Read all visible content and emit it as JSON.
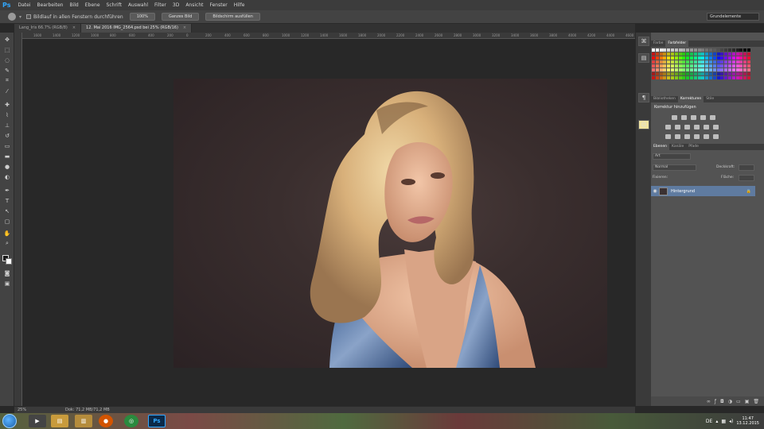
{
  "app": {
    "logo": "Ps"
  },
  "menu": [
    "Datei",
    "Bearbeiten",
    "Bild",
    "Ebene",
    "Schrift",
    "Auswahl",
    "Filter",
    "3D",
    "Ansicht",
    "Fenster",
    "Hilfe"
  ],
  "options": {
    "checkbox_label": "Bildlauf in allen Fenstern durchführen",
    "btn1": "100%",
    "btn2": "Ganzes Bild",
    "btn3": "Bildschirm ausfüllen",
    "workspace": "Grundelemente"
  },
  "tabs": [
    {
      "label": "Lang_Iris 66.7% (RGB/8)",
      "close": "×"
    },
    {
      "label": "12. Mai 2016 IMG_2564.psd bei 25% (RGB/16)",
      "close": "×"
    }
  ],
  "rulers": [
    "1600",
    "1400",
    "1200",
    "1000",
    "800",
    "600",
    "400",
    "200",
    "0",
    "200",
    "400",
    "600",
    "800",
    "1000",
    "1200",
    "1400",
    "1600",
    "1800",
    "2000",
    "2200",
    "2400",
    "2600",
    "2800",
    "3000",
    "3200",
    "3400",
    "3600",
    "3800",
    "4000",
    "4200",
    "4400",
    "4600"
  ],
  "status": {
    "zoom": "25%",
    "doc": "Dok: 71,2 MB/71,2 MB"
  },
  "panels": {
    "swatch_tabs": [
      "Farbe",
      "Farbfelder"
    ],
    "adjust_tabs": [
      "Bibliotheken",
      "Korrekturen",
      "Stile"
    ],
    "adjust_title": "Korrektur hinzufügen",
    "layer_tabs": [
      "Ebenen",
      "Kanäle",
      "Pfade"
    ],
    "layer_filter": "Art",
    "blend_mode": "Normal",
    "opacity_label": "Deckkraft:",
    "lock_label": "Fixieren:",
    "fill_label": "Fläche:",
    "layer_name": "Hintergrund"
  },
  "taskbar": {
    "lang": "DE",
    "time": "11:47",
    "date": "13.12.2015"
  },
  "icons": [
    "move-icon",
    "marquee-icon",
    "lasso-icon",
    "quick-select-icon",
    "crop-icon",
    "eyedropper-icon",
    "healing-icon",
    "brush-icon",
    "stamp-icon",
    "history-brush-icon",
    "eraser-icon",
    "gradient-icon",
    "blur-icon",
    "dodge-icon",
    "pen-icon",
    "type-icon",
    "path-select-icon",
    "shape-icon",
    "hand-icon",
    "zoom-icon"
  ]
}
